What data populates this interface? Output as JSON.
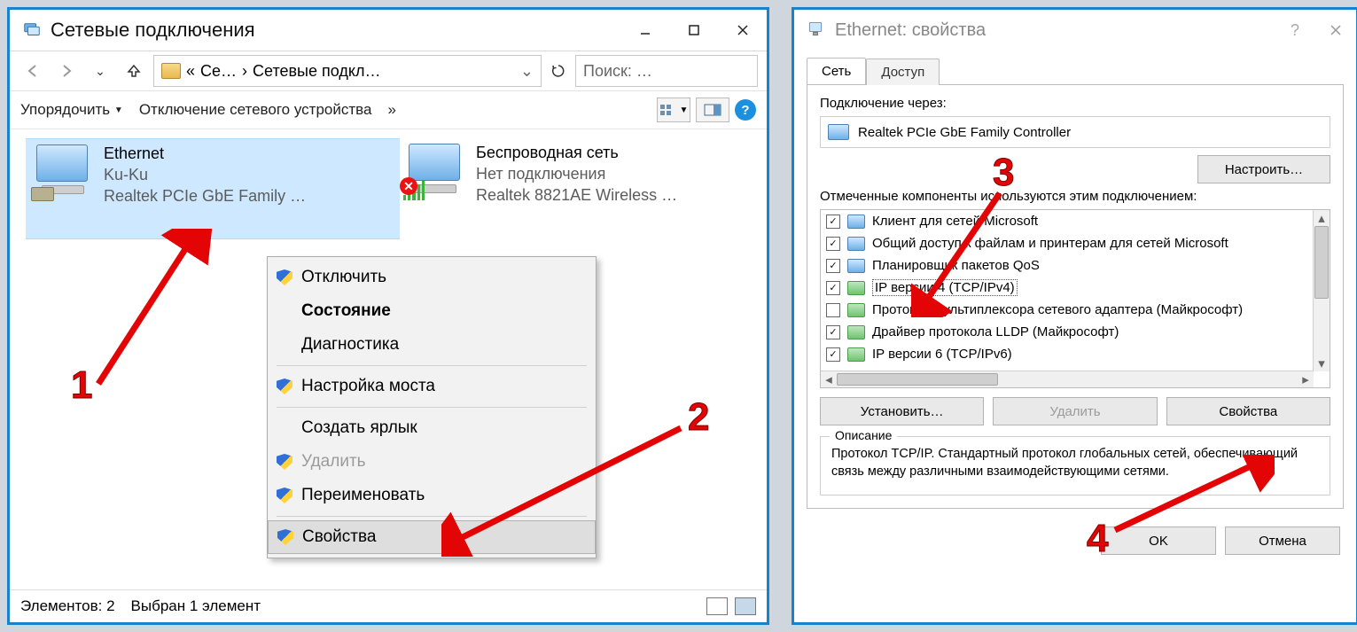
{
  "leftWindow": {
    "title": "Сетевые подключения",
    "breadcrumb": {
      "root": "Се…",
      "leaf": "Сетевые подкл…"
    },
    "search_placeholder": "Поиск: …",
    "toolbar": {
      "organize": "Упорядочить",
      "disable": "Отключение сетевого устройства",
      "more": "»"
    },
    "adapters": {
      "ethernet": {
        "name": "Ethernet",
        "status": "Ku-Ku",
        "device": "Realtek PCIe GbE Family …"
      },
      "wireless": {
        "name": "Беспроводная сеть",
        "status": "Нет подключения",
        "device": "Realtek 8821AE Wireless …"
      }
    },
    "context_menu": {
      "disable": "Отключить",
      "status": "Состояние",
      "diagnose": "Диагностика",
      "bridge": "Настройка моста",
      "shortcut": "Создать ярлык",
      "delete": "Удалить",
      "rename": "Переименовать",
      "properties": "Свойства"
    },
    "statusbar": {
      "elements": "Элементов: 2",
      "selected": "Выбран 1 элемент"
    }
  },
  "rightWindow": {
    "title": "Ethernet: свойства",
    "tabs": {
      "network": "Сеть",
      "access": "Доступ"
    },
    "connect_via_label": "Подключение через:",
    "adapter_name": "Realtek PCIe GbE Family Controller",
    "configure_btn": "Настроить…",
    "components_label": "Отмеченные компоненты используются этим подключением:",
    "components": [
      {
        "checked": true,
        "icon": "mon",
        "label": "Клиент для сетей Microsoft"
      },
      {
        "checked": true,
        "icon": "mon",
        "label": "Общий доступ к файлам и принтерам для сетей Microsoft"
      },
      {
        "checked": true,
        "icon": "mon",
        "label": "Планировщик пакетов QoS"
      },
      {
        "checked": true,
        "icon": "net",
        "label": "IP версии 4 (TCP/IPv4)",
        "highlight": true
      },
      {
        "checked": false,
        "icon": "net",
        "label": "Протокол мультиплексора сетевого адаптера (Майкрософт)"
      },
      {
        "checked": true,
        "icon": "net",
        "label": "Драйвер протокола LLDP (Майкрософт)"
      },
      {
        "checked": true,
        "icon": "net",
        "label": "IP версии 6 (TCP/IPv6)"
      }
    ],
    "buttons": {
      "install": "Установить…",
      "remove": "Удалить",
      "properties": "Свойства"
    },
    "description": {
      "label": "Описание",
      "text": "Протокол TCP/IP. Стандартный протокол глобальных сетей, обеспечивающий связь между различными взаимодействующими сетями."
    },
    "dialog": {
      "ok": "OK",
      "cancel": "Отмена"
    }
  },
  "annotations": {
    "n1": "1",
    "n2": "2",
    "n3": "3",
    "n4": "4"
  }
}
